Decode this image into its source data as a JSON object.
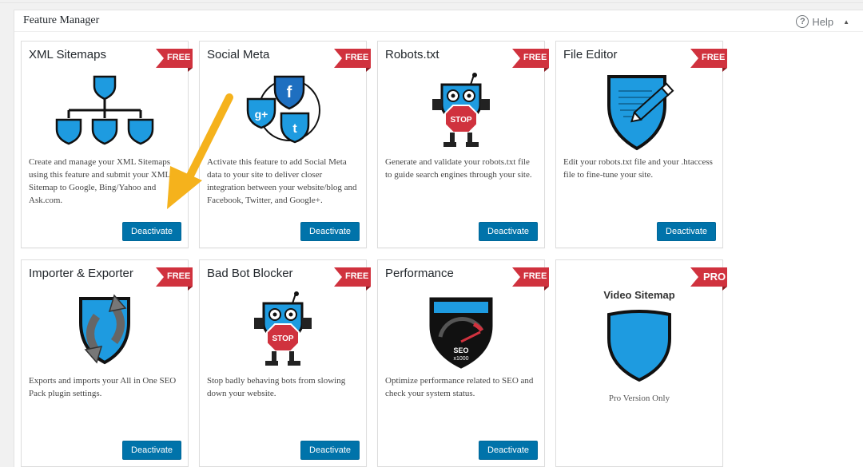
{
  "panel": {
    "title": "Feature Manager",
    "help_label": "Help"
  },
  "colors": {
    "accent": "#0073aa",
    "ribbon": "#d0323e",
    "shield": "#1e9be0",
    "arrow": "#f5b21c"
  },
  "cards": [
    {
      "title": "XML Sitemaps",
      "badge": "FREE",
      "icon": "sitemap-shield-icon",
      "desc": "Create and manage your XML Sitemaps using this feature and submit your XML Sitemap to Google, Bing/Yahoo and Ask.com.",
      "button": "Deactivate"
    },
    {
      "title": "Social Meta",
      "badge": "FREE",
      "icon": "social-bubbles-icon",
      "desc": "Activate this feature to add Social Meta data to your site to deliver closer integration between your website/blog and Facebook, Twitter, and Google+.",
      "button": "Deactivate"
    },
    {
      "title": "Robots.txt",
      "badge": "FREE",
      "icon": "robot-stop-icon",
      "desc": "Generate and validate your robots.txt file to guide search engines through your site.",
      "button": "Deactivate"
    },
    {
      "title": "File Editor",
      "badge": "FREE",
      "icon": "pencil-shield-icon",
      "desc": "Edit your robots.txt file and your .htaccess file to fine-tune your site.",
      "button": "Deactivate"
    },
    {
      "title": "Importer & Exporter",
      "badge": "FREE",
      "icon": "import-export-icon",
      "desc": "Exports and imports your All in One SEO Pack plugin settings.",
      "button": "Deactivate"
    },
    {
      "title": "Bad Bot Blocker",
      "badge": "FREE",
      "icon": "robot-stop-icon",
      "desc": "Stop badly behaving bots from slowing down your website.",
      "button": "Deactivate"
    },
    {
      "title": "Performance",
      "badge": "FREE",
      "icon": "speedometer-shield-icon",
      "desc": "Optimize performance related to SEO and check your system status.",
      "button": "Deactivate",
      "gauge_label_1": "SEO",
      "gauge_label_2": "x1000"
    },
    {
      "title": "Video Sitemap",
      "badge": "PRO",
      "icon": "shield-icon",
      "note": "Pro Version Only"
    }
  ],
  "robot_sign": "STOP"
}
